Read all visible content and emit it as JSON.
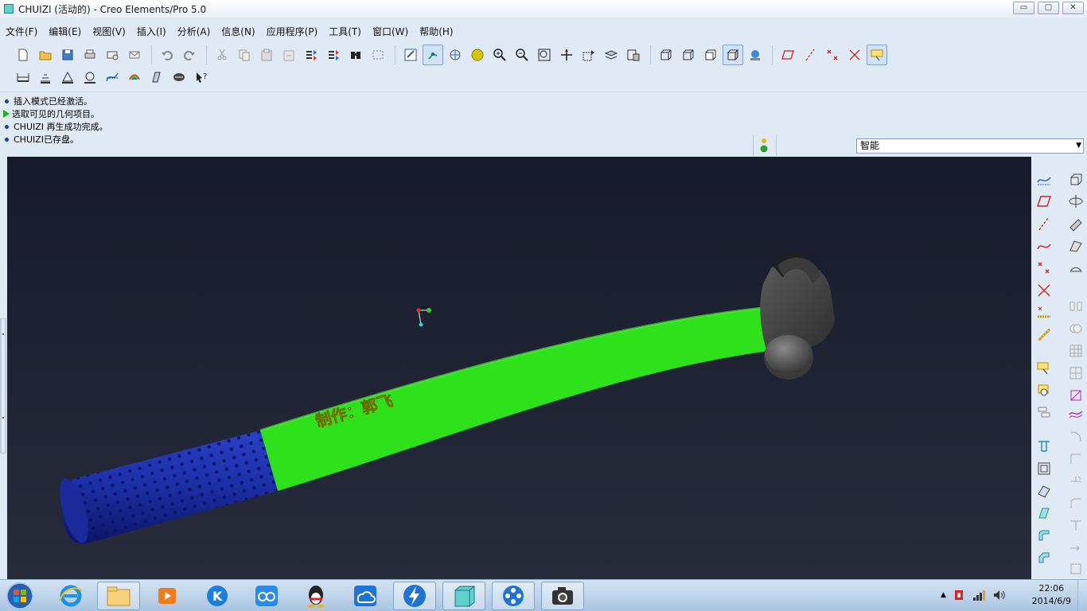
{
  "window": {
    "title": "CHUIZI (活动的) - Creo Elements/Pro 5.0",
    "minimize": "▭",
    "maximize": "▢",
    "close": "✕"
  },
  "menu": [
    "文件(F)",
    "编辑(E)",
    "视图(V)",
    "插入(I)",
    "分析(A)",
    "信息(N)",
    "应用程序(P)",
    "工具(T)",
    "窗口(W)",
    "帮助(H)"
  ],
  "messages": [
    {
      "type": "info",
      "text": "插入模式已经激活。"
    },
    {
      "type": "prompt",
      "text": "选取可见的几何项目。"
    },
    {
      "type": "info",
      "text": "CHUIZI 再生成功完成。"
    },
    {
      "type": "info",
      "text": "CHUIZI已存盘。"
    }
  ],
  "filter": {
    "selected": "智能"
  },
  "model": {
    "handle_text": "制作：郭飞",
    "colors": {
      "handle": "#2de21a",
      "grip": "#1b2fa5",
      "head": "#4a4a4a",
      "text": "#e8e61a"
    }
  },
  "taskbar": {
    "time": "22:06",
    "date": "2014/6/9"
  },
  "icons": {
    "toolbar1": [
      "new-file-icon",
      "open-file-icon",
      "save-icon",
      "print-icon",
      "send-mail-icon",
      "mail-icon",
      "undo-icon",
      "redo-icon",
      "cut-icon",
      "copy-icon",
      "paste-icon",
      "paste-special-icon",
      "regenerate-icon",
      "regen-manager-icon",
      "find-icon",
      "selection-box-icon",
      "repaint-icon",
      "spin-center-icon",
      "orient-mode-icon",
      "shade-sphere-icon",
      "zoom-in-icon",
      "zoom-out-icon",
      "refit-icon",
      "reorient-icon",
      "saved-views-icon",
      "layers-icon",
      "wireframe-icon",
      "hidden-line-icon",
      "no-hidden-icon",
      "shading-icon",
      "enhanced-realism-icon",
      "datum-plane-display-icon",
      "datum-axis-display-icon",
      "point-display-icon",
      "csys-display-icon",
      "annotation-display-icon"
    ],
    "toolbar2": [
      "measure-distance-icon",
      "measure-area-icon",
      "measure-angle-icon",
      "mass-properties-icon",
      "curve-analysis-icon",
      "surface-analysis-icon",
      "draft-analysis-icon",
      "saved-analysis-icon",
      "context-help-icon"
    ]
  }
}
